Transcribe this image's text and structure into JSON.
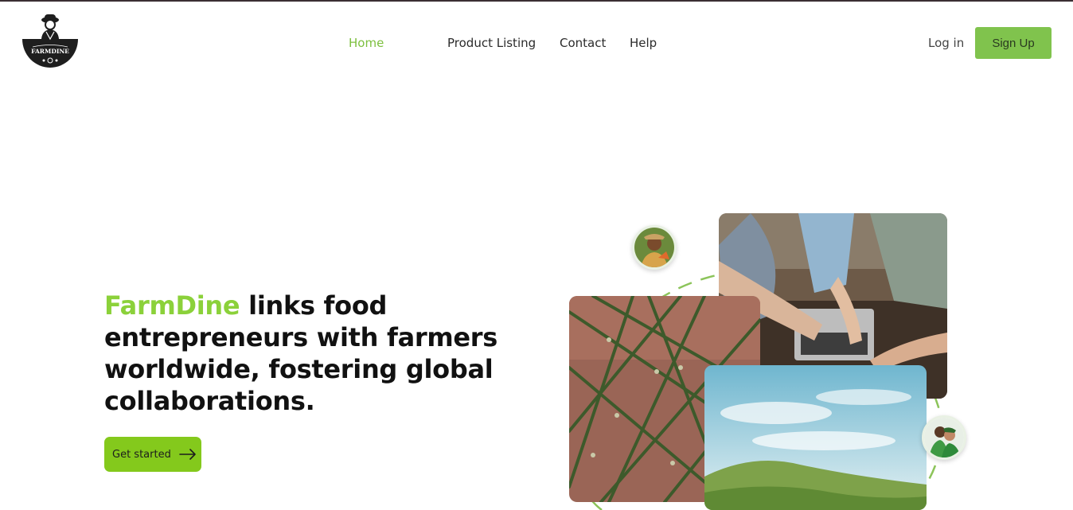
{
  "brand": {
    "logo_text": "FARMDINE"
  },
  "nav": {
    "items": [
      {
        "label": "Home",
        "active": true
      },
      {
        "label": "Product Listing",
        "active": false
      },
      {
        "label": "Contact",
        "active": false
      },
      {
        "label": "Help",
        "active": false
      }
    ],
    "login_label": "Log in",
    "signup_label": "Sign Up"
  },
  "hero": {
    "brand_word": "FarmDine",
    "headline_rest": " links food entrepreneurs with farmers worldwide, fostering global collaborations.",
    "cta_label": "Get started",
    "cta_icon": "arrow-right-icon"
  },
  "colors": {
    "accent": "#80c34d",
    "brand_text": "#8bd13a",
    "cta_bg": "#84c91c",
    "active_nav": "#7cbf3e"
  }
}
